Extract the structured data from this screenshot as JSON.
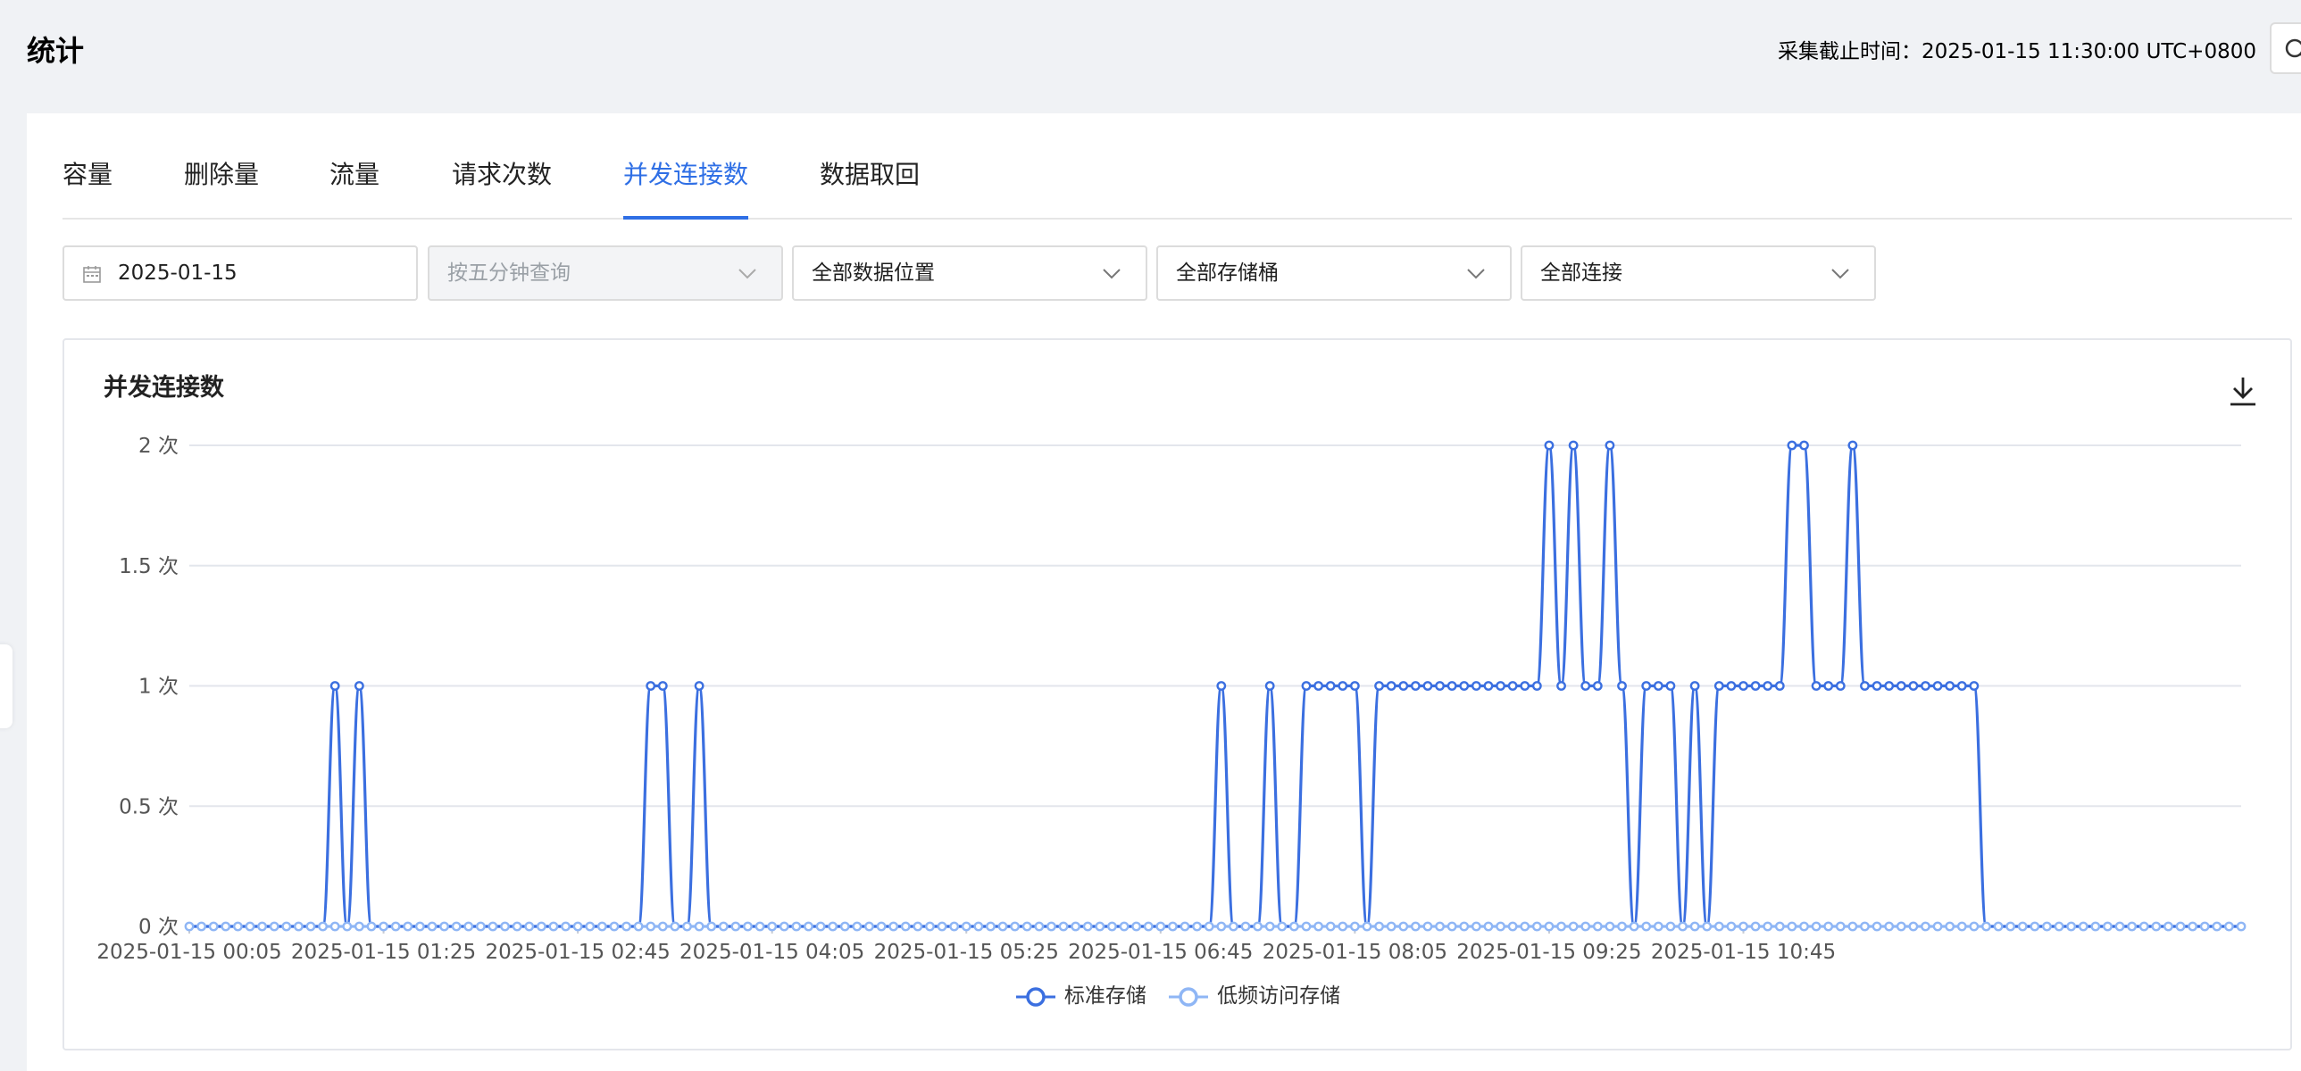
{
  "header": {
    "title": "统计",
    "cutoff_text": "采集截止时间：2025-01-15 11:30:00 UTC+0800"
  },
  "tabs": [
    {
      "label": "容量",
      "active": false
    },
    {
      "label": "删除量",
      "active": false
    },
    {
      "label": "流量",
      "active": false
    },
    {
      "label": "请求次数",
      "active": false
    },
    {
      "label": "并发连接数",
      "active": true
    },
    {
      "label": "数据取回",
      "active": false
    }
  ],
  "filters": {
    "date": "2025-01-15",
    "interval": "按五分钟查询",
    "location": "全部数据位置",
    "bucket": "全部存储桶",
    "connection": "全部连接"
  },
  "icons": {
    "search": "search-icon",
    "calendar": "calendar-icon",
    "chevron": "chevron-down-icon",
    "download": "download-icon",
    "collapse": "chevron-left-icon"
  },
  "colors": {
    "accent": "#2f6fe5",
    "series_standard": "#3b6fe0",
    "series_infrequent": "#8fb6f5"
  },
  "chart_data": {
    "type": "line",
    "title": "并发连接数",
    "xlabel": "",
    "ylabel": "",
    "ylim": [
      0,
      2
    ],
    "y_ticks": [
      "0 次",
      "0.5 次",
      "1 次",
      "1.5 次",
      "2 次"
    ],
    "y_tick_values": [
      0,
      0.5,
      1,
      1.5,
      2
    ],
    "x_ticks": [
      "2025-01-15 00:05",
      "2025-01-15 01:25",
      "2025-01-15 02:45",
      "2025-01-15 04:05",
      "2025-01-15 05:25",
      "2025-01-15 06:45",
      "2025-01-15 08:05",
      "2025-01-15 09:25",
      "2025-01-15 10:45"
    ],
    "x_start": "2025-01-15 00:05",
    "x_interval_minutes": 5,
    "grid": true,
    "legend": "bottom",
    "series": [
      {
        "name": "标准存储",
        "values": [
          0,
          0,
          0,
          0,
          0,
          0,
          0,
          0,
          0,
          0,
          0,
          0,
          1,
          0,
          1,
          0,
          0,
          0,
          0,
          0,
          0,
          0,
          0,
          0,
          0,
          0,
          0,
          0,
          0,
          0,
          0,
          0,
          0,
          0,
          0,
          0,
          0,
          0,
          1,
          1,
          0,
          0,
          1,
          0,
          0,
          0,
          0,
          0,
          0,
          0,
          0,
          0,
          0,
          0,
          0,
          0,
          0,
          0,
          0,
          0,
          0,
          0,
          0,
          0,
          0,
          0,
          0,
          0,
          0,
          0,
          0,
          0,
          0,
          0,
          0,
          0,
          0,
          0,
          0,
          0,
          0,
          0,
          0,
          0,
          0,
          1,
          0,
          0,
          0,
          1,
          0,
          0,
          1,
          1,
          1,
          1,
          1,
          0,
          1,
          1,
          1,
          1,
          1,
          1,
          1,
          1,
          1,
          1,
          1,
          1,
          1,
          1,
          2,
          1,
          2,
          1,
          1,
          2,
          1,
          0,
          1,
          1,
          1,
          0,
          1,
          0,
          1,
          1,
          1,
          1,
          1,
          1,
          2,
          2,
          1,
          1,
          1,
          2,
          1,
          1,
          1,
          1,
          1,
          1,
          1,
          1,
          1,
          1,
          0,
          0,
          0,
          0,
          0,
          0,
          0,
          0,
          0,
          0,
          0,
          0,
          0,
          0,
          0,
          0,
          0,
          0,
          0,
          0,
          0,
          0
        ]
      },
      {
        "name": "低频访问存储",
        "values": [
          0,
          0,
          0,
          0,
          0,
          0,
          0,
          0,
          0,
          0,
          0,
          0,
          0,
          0,
          0,
          0,
          0,
          0,
          0,
          0,
          0,
          0,
          0,
          0,
          0,
          0,
          0,
          0,
          0,
          0,
          0,
          0,
          0,
          0,
          0,
          0,
          0,
          0,
          0,
          0,
          0,
          0,
          0,
          0,
          0,
          0,
          0,
          0,
          0,
          0,
          0,
          0,
          0,
          0,
          0,
          0,
          0,
          0,
          0,
          0,
          0,
          0,
          0,
          0,
          0,
          0,
          0,
          0,
          0,
          0,
          0,
          0,
          0,
          0,
          0,
          0,
          0,
          0,
          0,
          0,
          0,
          0,
          0,
          0,
          0,
          0,
          0,
          0,
          0,
          0,
          0,
          0,
          0,
          0,
          0,
          0,
          0,
          0,
          0,
          0,
          0,
          0,
          0,
          0,
          0,
          0,
          0,
          0,
          0,
          0,
          0,
          0,
          0,
          0,
          0,
          0,
          0,
          0,
          0,
          0,
          0,
          0,
          0,
          0,
          0,
          0,
          0,
          0,
          0,
          0,
          0,
          0,
          0,
          0,
          0,
          0,
          0,
          0,
          0,
          0,
          0,
          0,
          0,
          0,
          0,
          0,
          0,
          0,
          0,
          0,
          0,
          0,
          0,
          0,
          0,
          0,
          0,
          0,
          0,
          0,
          0,
          0,
          0,
          0,
          0,
          0,
          0,
          0,
          0,
          0
        ]
      }
    ]
  }
}
